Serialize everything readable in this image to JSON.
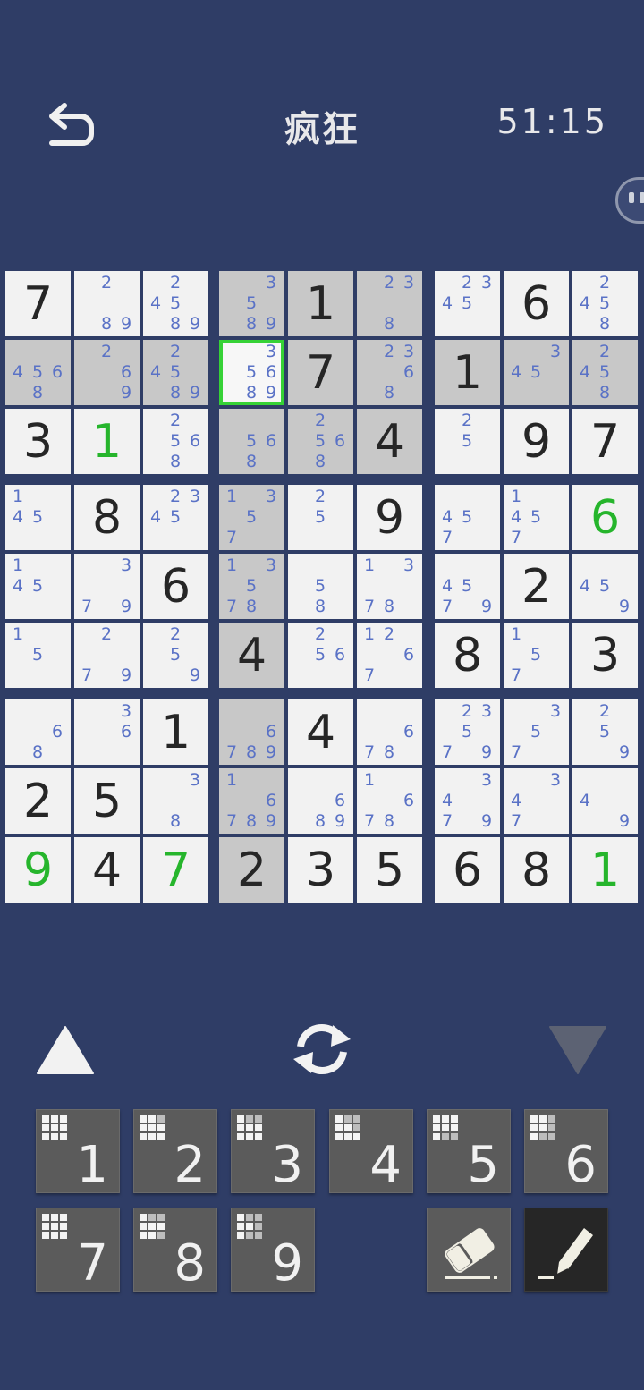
{
  "header": {
    "title": "疯狂",
    "timer": "51:15"
  },
  "colors": {
    "background": "#2f3d66",
    "cell": "#f2f2f2",
    "cell_highlight": "#c8c8c8",
    "selected_border": "#36d236",
    "note": "#5a72c6",
    "user_digit": "#26b52c",
    "given_digit": "#262626",
    "key": "#5b5b5b"
  },
  "board": {
    "selected": [
      1,
      3
    ],
    "highlighted_rows": [
      1
    ],
    "highlighted_cols": [
      3
    ],
    "highlighted_boxes": [
      1
    ],
    "cells": [
      [
        {
          "v": "7"
        },
        {
          "n": [
            2,
            8,
            9
          ]
        },
        {
          "n": [
            2,
            4,
            5,
            8,
            9
          ]
        },
        {
          "n": [
            3,
            5,
            8,
            9
          ]
        },
        {
          "v": "1"
        },
        {
          "n": [
            2,
            3,
            8
          ]
        },
        {
          "n": [
            2,
            3,
            4,
            5
          ]
        },
        {
          "v": "6"
        },
        {
          "n": [
            2,
            4,
            5,
            8
          ]
        }
      ],
      [
        {
          "n": [
            4,
            5,
            6,
            8
          ]
        },
        {
          "n": [
            2,
            6,
            9
          ]
        },
        {
          "n": [
            2,
            4,
            5,
            8,
            9
          ]
        },
        {
          "n": [
            3,
            5,
            6,
            8,
            9
          ]
        },
        {
          "v": "7"
        },
        {
          "n": [
            2,
            3,
            6,
            8
          ]
        },
        {
          "v": "1"
        },
        {
          "n": [
            3,
            4,
            5
          ]
        },
        {
          "n": [
            2,
            4,
            5,
            8
          ]
        }
      ],
      [
        {
          "v": "3"
        },
        {
          "v": "1",
          "g": true
        },
        {
          "n": [
            2,
            5,
            6,
            8
          ]
        },
        {
          "n": [
            5,
            6,
            8
          ]
        },
        {
          "n": [
            2,
            5,
            6,
            8
          ]
        },
        {
          "v": "4"
        },
        {
          "n": [
            2,
            5
          ]
        },
        {
          "v": "9"
        },
        {
          "v": "7"
        }
      ],
      [
        {
          "n": [
            1,
            4,
            5
          ]
        },
        {
          "v": "8"
        },
        {
          "n": [
            2,
            3,
            4,
            5
          ]
        },
        {
          "n": [
            1,
            3,
            5,
            7
          ]
        },
        {
          "n": [
            2,
            5
          ]
        },
        {
          "v": "9"
        },
        {
          "n": [
            4,
            5,
            7
          ]
        },
        {
          "n": [
            1,
            4,
            5,
            7
          ]
        },
        {
          "v": "6",
          "g": true
        }
      ],
      [
        {
          "n": [
            1,
            4,
            5
          ]
        },
        {
          "n": [
            3,
            7,
            9
          ]
        },
        {
          "v": "6"
        },
        {
          "n": [
            1,
            3,
            5,
            7,
            8
          ]
        },
        {
          "n": [
            5,
            8
          ]
        },
        {
          "n": [
            1,
            3,
            7,
            8
          ]
        },
        {
          "n": [
            4,
            5,
            7,
            9
          ]
        },
        {
          "v": "2"
        },
        {
          "n": [
            4,
            5,
            9
          ]
        }
      ],
      [
        {
          "n": [
            1,
            5
          ]
        },
        {
          "n": [
            2,
            7,
            9
          ]
        },
        {
          "n": [
            2,
            5,
            9
          ]
        },
        {
          "v": "4"
        },
        {
          "n": [
            2,
            5,
            6
          ]
        },
        {
          "n": [
            1,
            2,
            6,
            7
          ]
        },
        {
          "v": "8"
        },
        {
          "n": [
            1,
            5,
            7
          ]
        },
        {
          "v": "3"
        }
      ],
      [
        {
          "n": [
            6,
            8
          ]
        },
        {
          "n": [
            3,
            6
          ]
        },
        {
          "v": "1"
        },
        {
          "n": [
            6,
            7,
            8,
            9
          ]
        },
        {
          "v": "4"
        },
        {
          "n": [
            6,
            7,
            8
          ]
        },
        {
          "n": [
            2,
            3,
            5,
            7,
            9
          ]
        },
        {
          "n": [
            3,
            5,
            7
          ]
        },
        {
          "n": [
            2,
            5,
            9
          ]
        }
      ],
      [
        {
          "v": "2"
        },
        {
          "v": "5"
        },
        {
          "n": [
            3,
            8
          ]
        },
        {
          "n": [
            1,
            6,
            7,
            8,
            9
          ]
        },
        {
          "n": [
            6,
            8,
            9
          ]
        },
        {
          "n": [
            1,
            6,
            7,
            8
          ]
        },
        {
          "n": [
            3,
            4,
            7,
            9
          ]
        },
        {
          "n": [
            3,
            4,
            7
          ]
        },
        {
          "n": [
            4,
            9
          ]
        }
      ],
      [
        {
          "v": "9",
          "g": true
        },
        {
          "v": "4"
        },
        {
          "v": "7",
          "g": true
        },
        {
          "v": "2"
        },
        {
          "v": "3"
        },
        {
          "v": "5"
        },
        {
          "v": "6"
        },
        {
          "v": "8"
        },
        {
          "v": "1",
          "g": true
        }
      ]
    ]
  },
  "controls": {
    "prev_icon": "triangle-up-icon",
    "refresh_icon": "refresh-icon",
    "next_icon": "triangle-down-icon"
  },
  "numpad": {
    "keys": [
      {
        "label": "1",
        "dots": [
          1,
          1,
          1,
          1,
          1,
          1,
          1,
          1,
          1
        ]
      },
      {
        "label": "2",
        "dots": [
          1,
          1,
          0,
          1,
          1,
          1,
          1,
          1,
          1
        ]
      },
      {
        "label": "3",
        "dots": [
          1,
          0,
          0,
          1,
          1,
          1,
          1,
          1,
          1
        ]
      },
      {
        "label": "4",
        "dots": [
          1,
          0,
          0,
          1,
          1,
          0,
          1,
          1,
          1
        ]
      },
      {
        "label": "5",
        "dots": [
          1,
          1,
          1,
          1,
          1,
          1,
          1,
          0,
          0
        ]
      },
      {
        "label": "6",
        "dots": [
          1,
          1,
          0,
          1,
          1,
          0,
          1,
          0,
          0
        ]
      },
      {
        "label": "7",
        "dots": [
          1,
          1,
          1,
          1,
          1,
          1,
          1,
          1,
          1
        ]
      },
      {
        "label": "8",
        "dots": [
          1,
          0,
          0,
          1,
          1,
          1,
          1,
          1,
          0
        ]
      },
      {
        "label": "9",
        "dots": [
          1,
          0,
          0,
          1,
          1,
          0,
          1,
          0,
          0
        ]
      }
    ],
    "eraser_icon": "eraser-icon",
    "pencil_icon": "pencil-icon"
  }
}
